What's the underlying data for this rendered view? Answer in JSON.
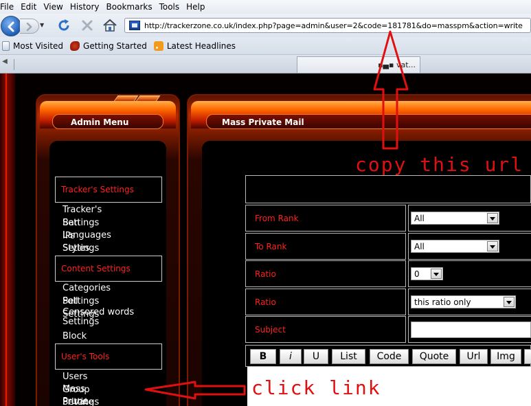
{
  "menubar": {
    "items": [
      "File",
      "Edit",
      "View",
      "History",
      "Bookmarks",
      "Tools",
      "Help"
    ]
  },
  "navbar": {
    "url": "http://trackerzone.co.uk/index.php?page=admin&user=2&code=181781&do=masspm&action=write"
  },
  "bookmarks": {
    "items": [
      "Most Visited",
      "Getting Started",
      "Latest Headlines"
    ]
  },
  "tabbar": {
    "tab_label": "▪▄▪ vat..."
  },
  "admin_menu": {
    "title": "Admin Menu",
    "sections": [
      {
        "heading": "Tracker's Settings",
        "links": [
          "Tracker's Settings",
          "Ban IPs",
          "Languages Settings",
          "Styles Settings"
        ]
      },
      {
        "heading": "Content Settings",
        "links": [
          "Categories Settings",
          "Poll Settings",
          "Censored words Settings",
          "Block Settings"
        ]
      },
      {
        "heading": "User's Tools",
        "links": [
          "Users Group Settings",
          "Mass Private Mail",
          "Prune Users"
        ]
      }
    ]
  },
  "mass_pm": {
    "title": "Mass Private Mail",
    "rows": [
      {
        "label": "From Rank",
        "value": "All"
      },
      {
        "label": "To Rank",
        "value": "All"
      },
      {
        "label": "Ratio",
        "value": "0"
      },
      {
        "label": "Ratio",
        "value": "this ratio only"
      },
      {
        "label": "Subject",
        "value": ""
      }
    ],
    "editor_buttons": [
      "B",
      "i",
      "U",
      "List",
      "Code",
      "Quote",
      "Url",
      "Img"
    ]
  },
  "annotations": {
    "copy_url": "copy this url",
    "click_link": "click link"
  },
  "colors": {
    "annotation_red": "#e01010",
    "label_red": "#ff2020",
    "link_white": "#ffffff"
  }
}
